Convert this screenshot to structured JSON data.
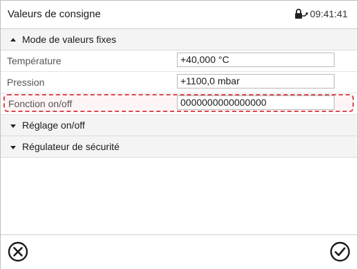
{
  "header": {
    "title": "Valeurs de consigne",
    "time": "09:41:41",
    "status_icon": "lock-icon"
  },
  "sections": [
    {
      "label": "Mode de valeurs fixes",
      "expanded": true
    },
    {
      "label": "Réglage on/off",
      "expanded": false
    },
    {
      "label": "Régulateur de sécurité",
      "expanded": false
    }
  ],
  "rows": [
    {
      "label": "Température",
      "value": "+40,000 °C"
    },
    {
      "label": "Pression",
      "value": "+1100,0 mbar"
    },
    {
      "label": "Fonction on/off",
      "value": "0000000000000000",
      "highlighted": true
    }
  ],
  "footer": {
    "cancel_icon": "close-circle-icon",
    "confirm_icon": "check-circle-icon"
  }
}
